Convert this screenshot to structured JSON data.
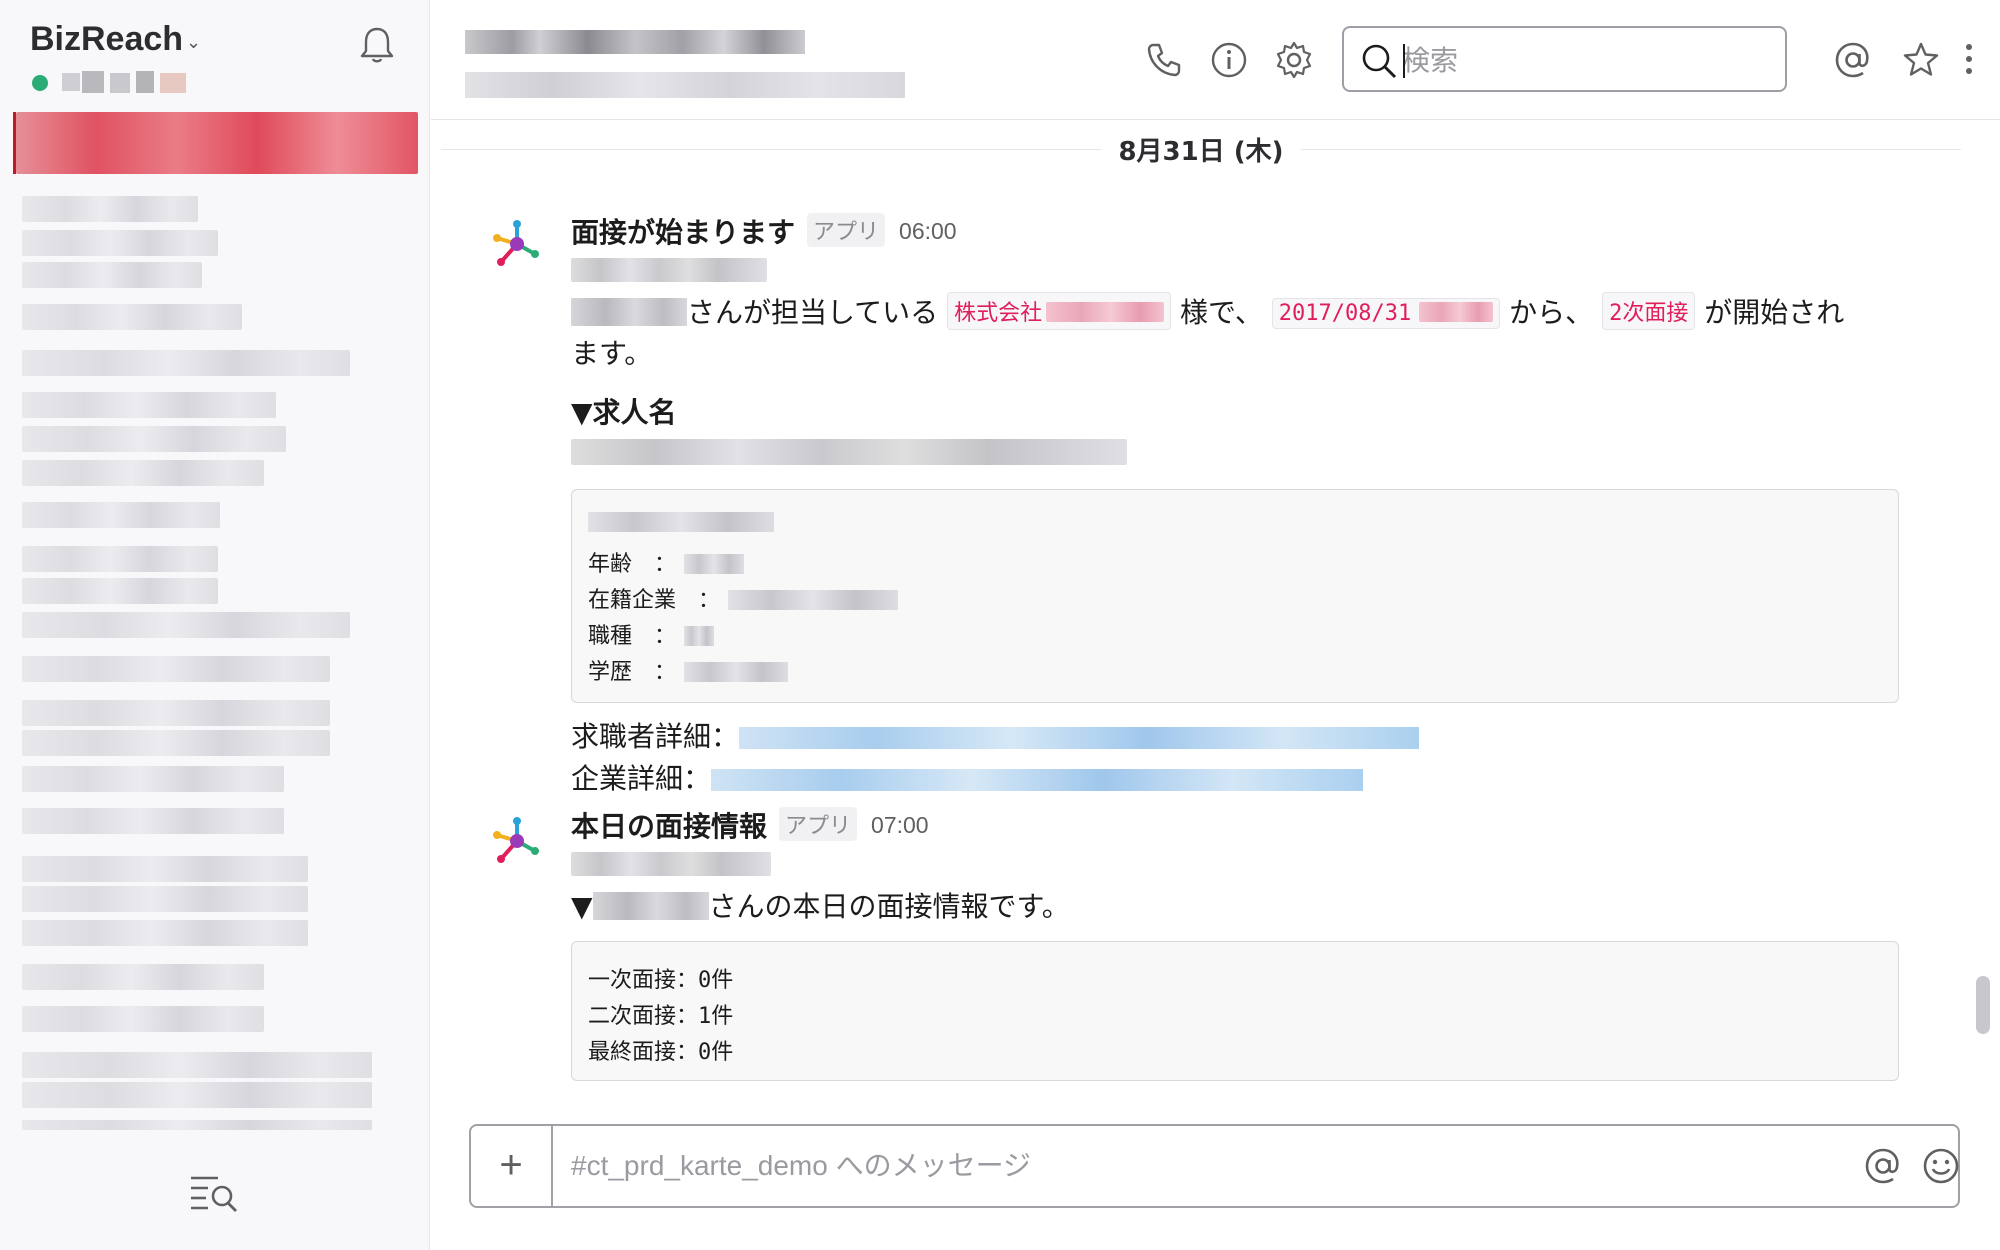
{
  "workspace": {
    "name": "BizReach"
  },
  "header": {
    "search_placeholder": "検索"
  },
  "day_divider": "8月31日 (木)",
  "messages": [
    {
      "sender": "面接が始まります",
      "badge": "アプリ",
      "time": "06:00",
      "line1_a": "さんが担当している",
      "code_company": "株式会社",
      "line1_b": "様で、",
      "code_date": "2017/08/31",
      "line1_c": "から、",
      "code_stage": "2次面接",
      "line1_d": "が開始され",
      "line2": "ます。",
      "heading": "▼求人名",
      "attach_fields": [
        "年齢　：",
        "在籍企業　：",
        "職種　：",
        "学歴　："
      ],
      "link1_label": "求職者詳細：",
      "link2_label": "企業詳細："
    },
    {
      "sender": "本日の面接情報",
      "badge": "アプリ",
      "time": "07:00",
      "line1_prefix": "▼",
      "line1_suffix": "さんの本日の面接情報です。",
      "attach_lines": [
        "一次面接：0件",
        "二次面接：1件",
        "最終面接：0件"
      ]
    }
  ],
  "composer": {
    "placeholder": "#ct_prd_karte_demo へのメッセージ"
  },
  "colors": {
    "accent_red": "#e01e5a",
    "presence_green": "#2bac76",
    "selected_channel": "#e05262"
  }
}
